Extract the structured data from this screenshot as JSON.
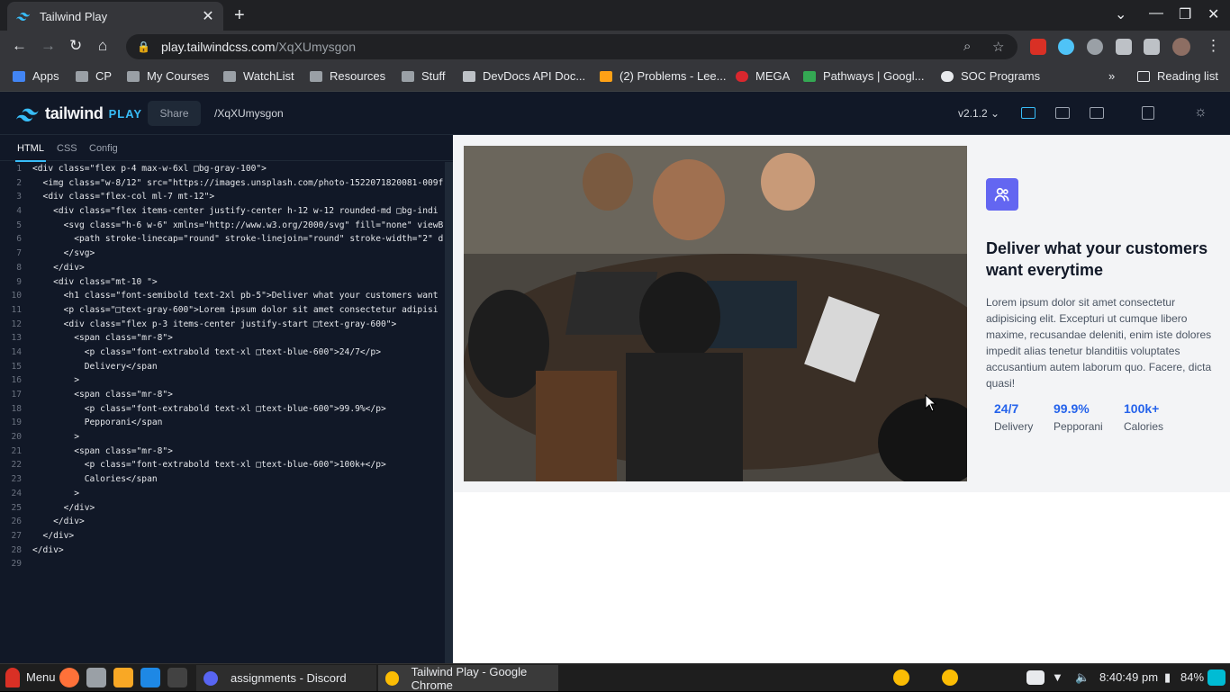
{
  "browser": {
    "tab_title": "Tailwind Play",
    "url_host": "play.tailwindcss.com",
    "url_path": "/XqXUmysgon",
    "bookmarks": [
      "Apps",
      "CP",
      "My Courses",
      "WatchList",
      "Resources",
      "Stuff",
      "DevDocs API Doc...",
      "(2) Problems - Lee...",
      "MEGA",
      "Pathways | Googl...",
      "SOC Programs"
    ],
    "reading_list": "Reading list"
  },
  "play": {
    "brand": "tailwind",
    "brand_suffix": "PLAY",
    "share_label": "Share",
    "slug": "/XqXUmysgon",
    "version": "v2.1.2",
    "editor_tabs": [
      "HTML",
      "CSS",
      "Config"
    ]
  },
  "code_lines": [
    "<div class=\"flex p-4 max-w-6xl □bg-gray-100\">",
    "  <img class=\"w-8/12\" src=\"https://images.unsplash.com/photo-1522071820081-009f",
    "  <div class=\"flex-col ml-7 mt-12\">",
    "    <div class=\"flex items-center justify-center h-12 w-12 rounded-md □bg-indi",
    "      <svg class=\"h-6 w-6\" xmlns=\"http://www.w3.org/2000/svg\" fill=\"none\" viewB",
    "        <path stroke-linecap=\"round\" stroke-linejoin=\"round\" stroke-width=\"2\" d",
    "      </svg>",
    "    </div>",
    "    <div class=\"mt-10 \">",
    "      <h1 class=\"font-semibold text-2xl pb-5\">Deliver what your customers want",
    "      <p class=\"□text-gray-600\">Lorem ipsum dolor sit amet consectetur adipisi",
    "      <div class=\"flex p-3 items-center justify-start □text-gray-600\">",
    "        <span class=\"mr-8\">",
    "          <p class=\"font-extrabold text-xl □text-blue-600\">24/7</p>",
    "          Delivery</span",
    "        >",
    "        <span class=\"mr-8\">",
    "          <p class=\"font-extrabold text-xl □text-blue-600\">99.9%</p>",
    "          Pepporani</span",
    "        >",
    "        <span class=\"mr-8\">",
    "          <p class=\"font-extrabold text-xl □text-blue-600\">100k+</p>",
    "          Calories</span",
    "        >",
    "      </div>",
    "    </div>",
    "  </div>",
    "</div>",
    ""
  ],
  "preview": {
    "heading": "Deliver what your customers want everytime",
    "paragraph": "Lorem ipsum dolor sit amet consectetur adipisicing elit. Excepturi ut cumque libero maxime, recusandae deleniti, enim iste dolores impedit alias tenetur blanditiis voluptates accusantium autem laborum quo. Facere, dicta quasi!",
    "stats": [
      {
        "value": "24/7",
        "label": "Delivery"
      },
      {
        "value": "99.9%",
        "label": "Pepporani"
      },
      {
        "value": "100k+",
        "label": "Calories"
      }
    ]
  },
  "taskbar": {
    "menu_label": "Menu",
    "window1": "assignments - Discord",
    "window2": "Tailwind Play - Google Chrome",
    "clock": "8:40:49 pm",
    "battery": "84%"
  }
}
